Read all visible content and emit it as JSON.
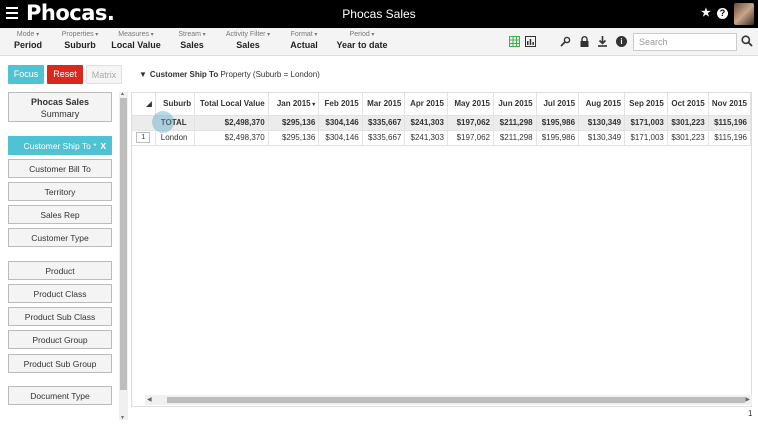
{
  "app": {
    "logo": "Phocas.",
    "title": "Phocas Sales"
  },
  "toolbar": [
    {
      "label": "Mode",
      "value": "Period"
    },
    {
      "label": "Properties",
      "value": "Suburb"
    },
    {
      "label": "Measures",
      "value": "Local Value"
    },
    {
      "label": "Stream",
      "value": "Sales"
    },
    {
      "label": "Activity Filter",
      "value": "Sales"
    },
    {
      "label": "Format",
      "value": "Actual"
    },
    {
      "label": "Period",
      "value": "Year to date"
    }
  ],
  "search": {
    "placeholder": "Search"
  },
  "buttons": {
    "focus": "Focus",
    "reset": "Reset",
    "matrix": "Matrix"
  },
  "filter": {
    "dimension": "Customer Ship To",
    "detail": "Property (Suburb = London)"
  },
  "sidebar": {
    "summary_title": "Phocas Sales",
    "summary_sub": "Summary",
    "active": "Customer Ship To *",
    "active_remove": "X",
    "dimensions": [
      "Customer Bill To",
      "Territory",
      "Sales Rep",
      "Customer Type",
      "Product",
      "Product Class",
      "Product Sub Class",
      "Product Group",
      "Product Sub Group",
      "Document Type"
    ]
  },
  "grid": {
    "columns": [
      "Suburb",
      "Total Local Value",
      "Jan 2015",
      "Feb 2015",
      "Mar 2015",
      "Apr 2015",
      "May 2015",
      "Jun 2015",
      "Jul 2015",
      "Aug 2015",
      "Sep 2015",
      "Oct 2015",
      "Nov 2015"
    ],
    "total": [
      "TOTAL",
      "$2,498,370",
      "$295,136",
      "$304,146",
      "$335,667",
      "$241,303",
      "$197,062",
      "$211,298",
      "$195,986",
      "$130,349",
      "$171,003",
      "$301,223",
      "$115,196"
    ],
    "rows": [
      {
        "num": "1",
        "cells": [
          "London",
          "$2,498,370",
          "$295,136",
          "$304,146",
          "$335,667",
          "$241,303",
          "$197,062",
          "$211,298",
          "$195,986",
          "$130,349",
          "$171,003",
          "$301,223",
          "$115,196"
        ]
      }
    ]
  },
  "footer": {
    "count": "1"
  }
}
